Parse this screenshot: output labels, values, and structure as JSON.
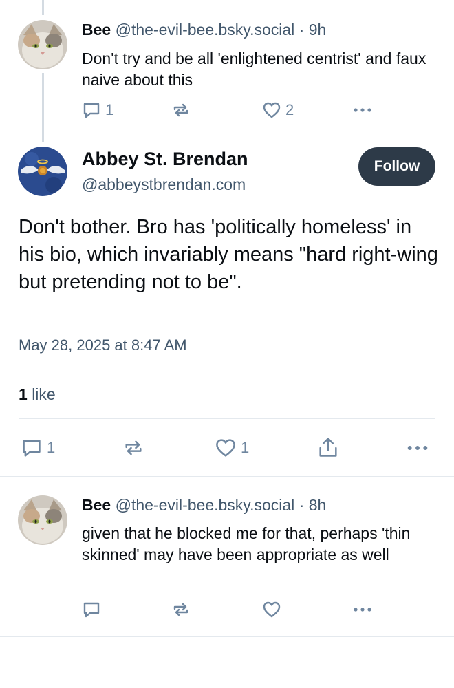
{
  "reply1": {
    "name": "Bee",
    "handle": "@the-evil-bee.bsky.social",
    "separator": "·",
    "time": "9h",
    "text": "Don't try and be all 'enlightened centrist' and faux naive about this",
    "reply_count": "1",
    "like_count": "2"
  },
  "main_post": {
    "name": "Abbey St. Brendan",
    "handle": "@abbeystbrendan.com",
    "follow_label": "Follow",
    "text": "Don't bother. Bro has 'politically homeless' in his bio, which invariably means \"hard right-wing but pretending not to be\".",
    "date": "May 28, 2025 at 8:47 AM",
    "likes_number": "1",
    "likes_label": "like",
    "reply_count": "1",
    "like_count": "1"
  },
  "reply2": {
    "name": "Bee",
    "handle": "@the-evil-bee.bsky.social",
    "separator": "·",
    "time": "8h",
    "text": "given that he blocked me for that, perhaps 'thin skinned' may have been appropriate as well"
  },
  "colors": {
    "text_primary": "#0b0f14",
    "text_secondary": "#42576c",
    "icon": "#6f869f",
    "follow_bg": "#2d3a48",
    "thread_line": "#d4dbe2"
  }
}
